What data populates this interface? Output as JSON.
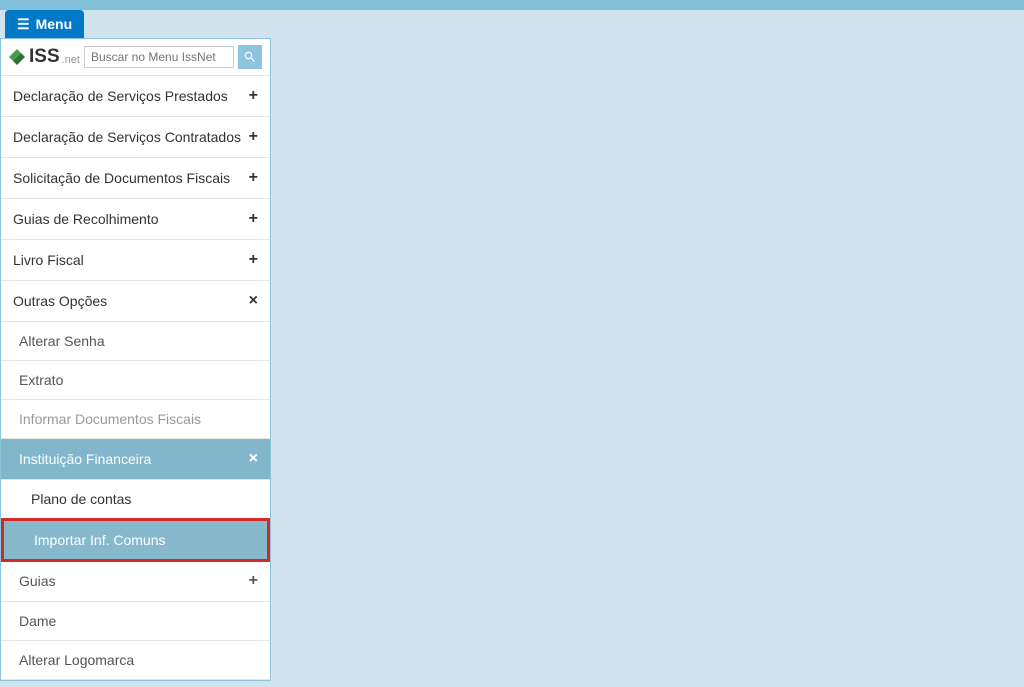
{
  "menuButton": "Menu",
  "logo": {
    "main": "ISS",
    "sub": ".net"
  },
  "search": {
    "placeholder": "Buscar no Menu IssNet"
  },
  "menu": {
    "item0": {
      "label": "Declaração de Serviços Prestados",
      "toggle": "+"
    },
    "item1": {
      "label": "Declaração de Serviços Contratados",
      "toggle": "+"
    },
    "item2": {
      "label": "Solicitação de Documentos Fiscais",
      "toggle": "+"
    },
    "item3": {
      "label": "Guias de Recolhimento",
      "toggle": "+"
    },
    "item4": {
      "label": "Livro Fiscal",
      "toggle": "+"
    },
    "item5": {
      "label": "Outras Opções",
      "toggle": "×"
    }
  },
  "submenu": {
    "s0": {
      "label": "Alterar Senha"
    },
    "s1": {
      "label": "Extrato"
    },
    "s2": {
      "label": "Informar Documentos Fiscais"
    },
    "s3": {
      "label": "Instituição Financeira",
      "toggle": "×"
    },
    "s4": {
      "label": "Guias",
      "toggle": "+"
    },
    "s5": {
      "label": "Dame"
    },
    "s6": {
      "label": "Alterar Logomarca"
    }
  },
  "sub2": {
    "a0": {
      "label": "Plano de contas"
    },
    "a1": {
      "label": "Importar Inf. Comuns"
    }
  }
}
